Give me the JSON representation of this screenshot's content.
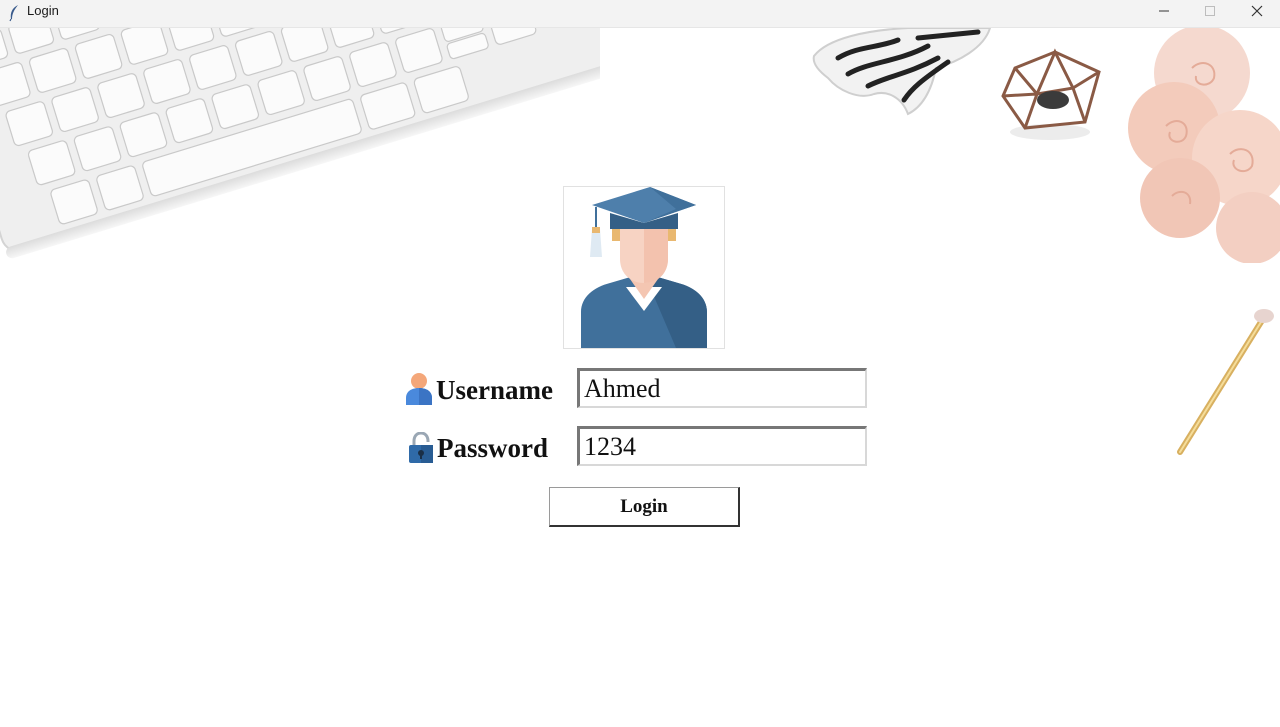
{
  "window": {
    "title": "Login",
    "controls": [
      "minimize",
      "maximize",
      "close"
    ]
  },
  "icons": {
    "app": "feather-icon",
    "avatar": "graduate-avatar-icon",
    "username": "user-icon",
    "password": "padlock-icon"
  },
  "form": {
    "username_label": "Username",
    "username_value": "Ahmed",
    "password_label": "Password",
    "password_value": "1234",
    "login_button": "Login"
  },
  "colors": {
    "titlebar": "#f3f3f3",
    "background": "#ffffff",
    "avatar_blue": "#40709b",
    "text": "#111111"
  }
}
